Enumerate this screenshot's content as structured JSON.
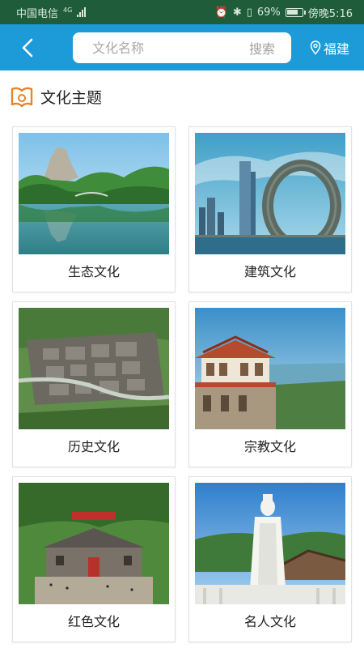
{
  "status_bar": {
    "carrier": "中国电信",
    "network": "4G",
    "battery": "69%",
    "time": "傍晚5:16"
  },
  "header": {
    "search_placeholder": "文化名称",
    "search_button": "搜索",
    "location": "福建"
  },
  "section": {
    "title": "文化主题"
  },
  "cards": [
    {
      "label": "生态文化"
    },
    {
      "label": "建筑文化"
    },
    {
      "label": "历史文化"
    },
    {
      "label": "宗教文化"
    },
    {
      "label": "红色文化"
    },
    {
      "label": "名人文化"
    }
  ],
  "colors": {
    "header": "#1d9ad8",
    "status_bar": "#1e5c3a",
    "accent_icon": "#e8832a"
  }
}
